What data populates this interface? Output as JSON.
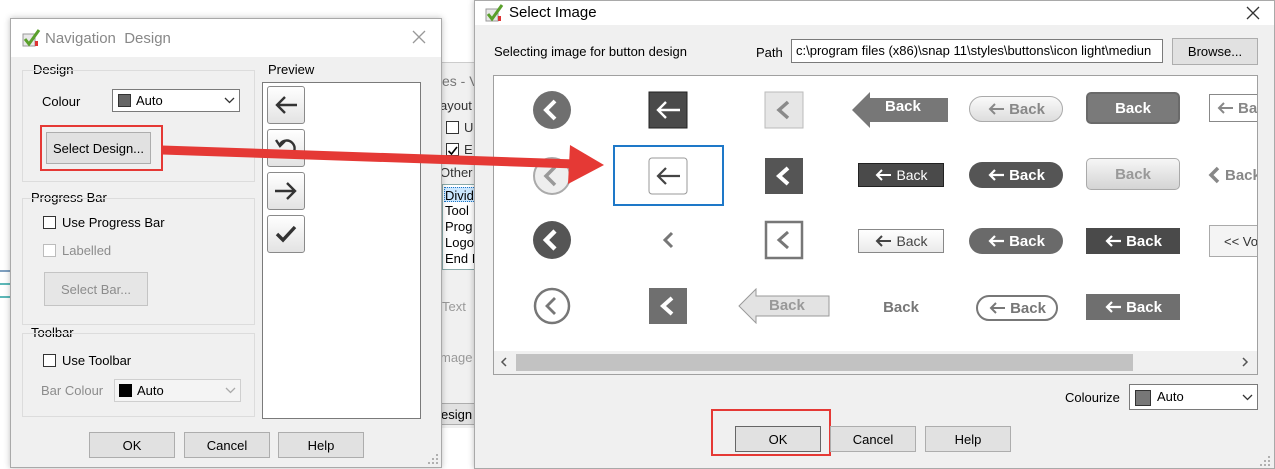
{
  "background_window": {
    "title": "es - V",
    "layout_label": "ayout s",
    "checkbox_1": "U",
    "checkbox_2": "E",
    "other_label": "Other",
    "list_items": [
      "Divid",
      "Tool",
      "Prog",
      "Logo",
      "End I"
    ],
    "text_label": "Text",
    "image_label": "mage",
    "design_button": "esign"
  },
  "nav_dialog": {
    "title": "Navigation  Design",
    "design_group": "Design",
    "colour_label": "Colour",
    "colour_value": "Auto",
    "select_design_button": "Select Design...",
    "progress_group": "Progress Bar",
    "use_progress_bar": "Use Progress Bar",
    "labelled": "Labelled",
    "select_bar_button": "Select Bar...",
    "toolbar_group": "Toolbar",
    "use_toolbar": "Use Toolbar",
    "bar_colour_label": "Bar Colour",
    "bar_colour_value": "Auto",
    "preview_label": "Preview",
    "ok": "OK",
    "cancel": "Cancel",
    "help": "Help"
  },
  "select_dialog": {
    "title": "Select Image",
    "subtitle": "Selecting image for button design",
    "path_label": "Path",
    "path_value": "c:\\program files (x86)\\snap 11\\styles\\buttons\\icon light\\mediun",
    "browse_button": "Browse...",
    "back_text": "Back",
    "vo_text": "<< Vo",
    "ba_text": "Ba",
    "colourize_label": "Colourize",
    "colourize_value": "Auto",
    "ok": "OK",
    "cancel": "Cancel",
    "help": "Help"
  },
  "colors": {
    "highlight_red": "#e53935",
    "selection_blue": "#1e78c8",
    "icon_gray": "#6f6f6f",
    "list_select": "#cce8ff"
  }
}
